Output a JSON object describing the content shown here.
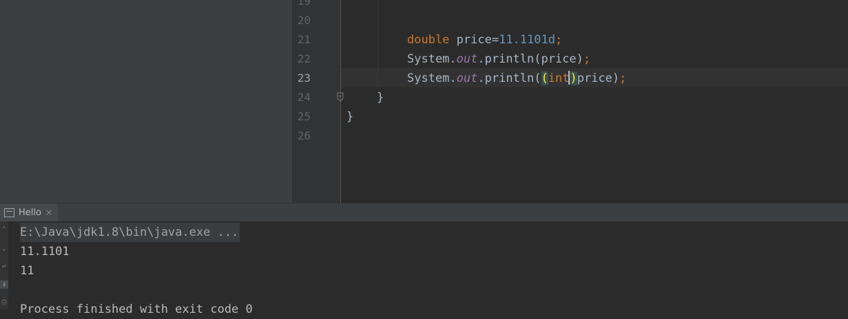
{
  "editor": {
    "lines": [
      {
        "num": "19",
        "tokens": []
      },
      {
        "num": "20",
        "tokens": []
      },
      {
        "num": "21",
        "tokens": [
          {
            "cls": "kw",
            "text": "double"
          },
          {
            "cls": "",
            "text": " price="
          },
          {
            "cls": "num",
            "text": "11.1101d"
          },
          {
            "cls": "kw",
            "text": ";"
          }
        ]
      },
      {
        "num": "22",
        "tokens": [
          {
            "cls": "",
            "text": "System."
          },
          {
            "cls": "field",
            "text": "out"
          },
          {
            "cls": "",
            "text": ".println(price)"
          },
          {
            "cls": "kw",
            "text": ";"
          }
        ]
      },
      {
        "num": "23",
        "current": true,
        "tokens": [
          {
            "cls": "",
            "text": "System."
          },
          {
            "cls": "field",
            "text": "out"
          },
          {
            "cls": "",
            "text": ".println("
          },
          {
            "cls": "paren-match",
            "text": "("
          },
          {
            "cls": "kw",
            "text": "int"
          },
          {
            "cls": "caret",
            "text": ""
          },
          {
            "cls": "paren-match",
            "text": ")"
          },
          {
            "cls": "",
            "text": "price)"
          },
          {
            "cls": "kw",
            "text": ";"
          }
        ]
      },
      {
        "num": "24",
        "tokens": [
          {
            "cls": "",
            "text": "}"
          }
        ]
      },
      {
        "num": "25",
        "tokens": [
          {
            "cls": "",
            "text": "}"
          }
        ]
      },
      {
        "num": "26",
        "tokens": []
      }
    ]
  },
  "run_panel": {
    "tab_label": "Hello",
    "tab_close": "×",
    "output": [
      "E:\\Java\\jdk1.8\\bin\\java.exe ...",
      "11.1101",
      "11",
      "",
      "Process finished with exit code 0"
    ],
    "strip_icons": [
      "up-arrow-icon",
      "down-arrow-icon",
      "wrap-icon",
      "scroll-to-end-icon",
      "print-icon"
    ]
  }
}
